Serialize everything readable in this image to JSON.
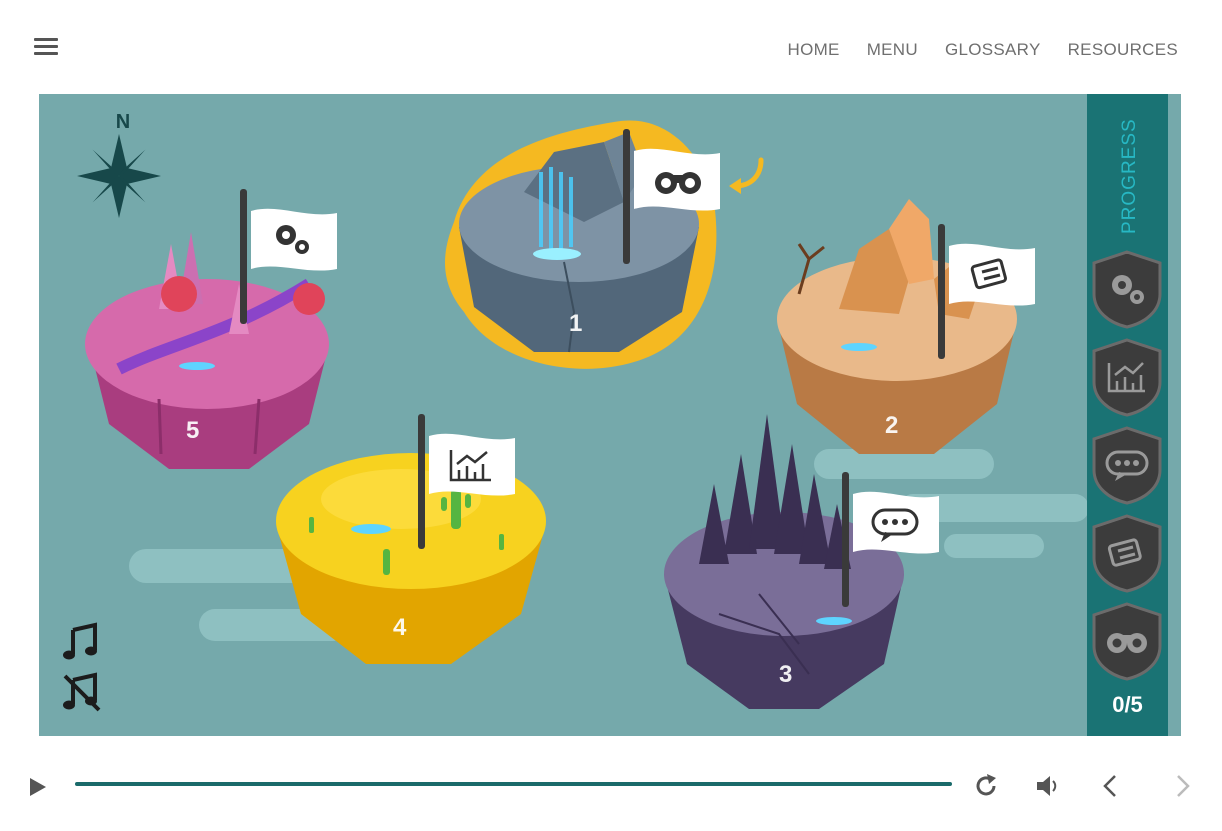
{
  "nav": {
    "items": [
      "HOME",
      "MENU",
      "GLOSSARY",
      "RESOURCES"
    ]
  },
  "compass": {
    "label": "N"
  },
  "islands": [
    {
      "number": "1",
      "icon": "binoculars-icon",
      "color": "#5f7688",
      "highlighted": true
    },
    {
      "number": "2",
      "icon": "scroll-icon",
      "color": "#d99a5c"
    },
    {
      "number": "3",
      "icon": "speech-bubble-icon",
      "color": "#5d4f7a"
    },
    {
      "number": "4",
      "icon": "chart-icon",
      "color": "#f2c21a"
    },
    {
      "number": "5",
      "icon": "gears-icon",
      "color": "#c85a9b"
    }
  ],
  "progress": {
    "title": "PROGRESS",
    "count": "0/5",
    "badges": [
      "gears-icon",
      "chart-icon",
      "speech-bubble-icon",
      "scroll-icon",
      "binoculars-icon"
    ]
  },
  "colors": {
    "stage_bg": "#75a9ab",
    "panel_bg": "#1a7374",
    "accent": "#f5b921",
    "progress_title": "#27b8c4"
  }
}
